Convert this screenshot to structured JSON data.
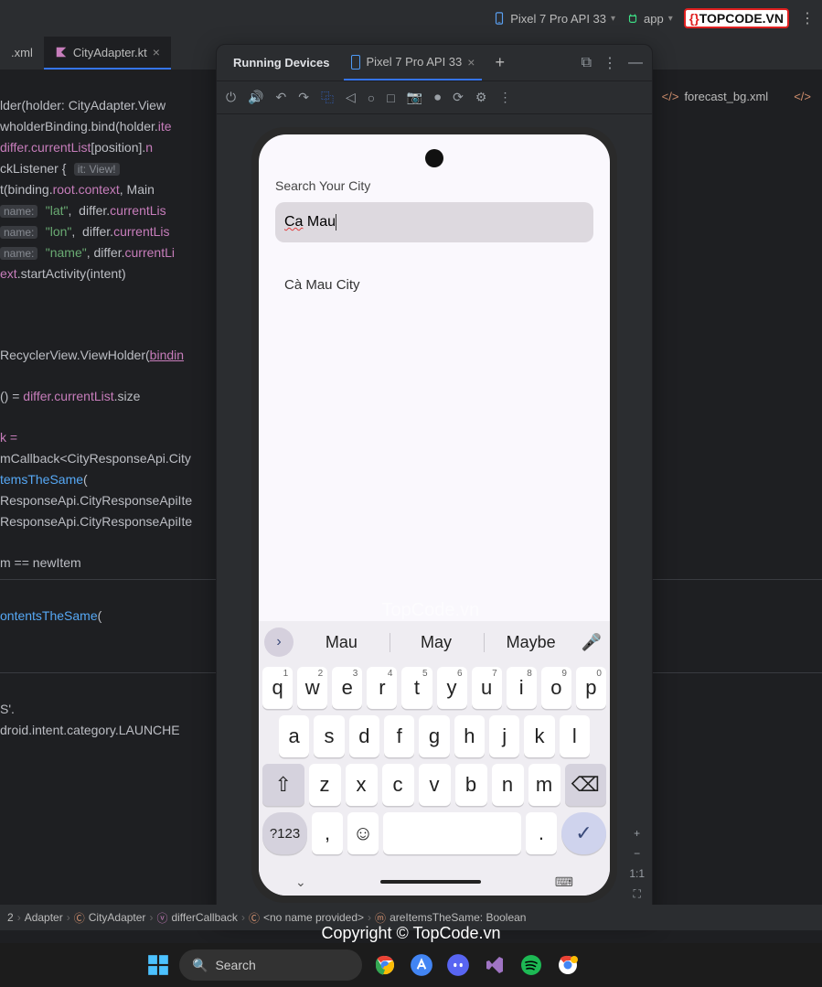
{
  "top_toolbar": {
    "device": "Pixel 7 Pro API 33",
    "run_config": "app"
  },
  "logo_text": "TOPCODE.VN",
  "editor_tabs": {
    "left_tail": ".xml",
    "active": "CityAdapter.kt",
    "right1": "forecast_bg.xml"
  },
  "code": {
    "l1a": "lder(holder: CityAdapter.View",
    "l2a": "wholderBinding.bind(holder.",
    "l2b": "ite",
    "l3a": "differ",
    "l3b": ".currentList",
    "l3c": "[position].",
    "l3d": "n",
    "l4a": "ckListener {",
    "l4hint": "it: View!",
    "l5a": "t(binding.",
    "l5b": "root",
    "l5c": ".context",
    "l5d": ", Main",
    "l6hint": "name:",
    "l6a": "\"lat\"",
    "l6b": ",  differ.",
    "l6c": "currentLis",
    "l7hint": "name:",
    "l7a": "\"lon\"",
    "l7b": ",  differ.",
    "l7c": "currentLis",
    "l8hint": "name:",
    "l8a": "\"name\"",
    "l8b": ", differ.",
    "l8c": "currentLi",
    "l9a": "ext",
    "l9b": ".startActivity(intent)",
    "l10a": "RecyclerView.ViewHolder(",
    "l10b": "bindin",
    "l11a": "() = ",
    "l11b": "differ",
    "l11c": ".currentList",
    "l11d": ".size",
    "l12a": "k =",
    "l13a": "mCallback<CityResponseApi.City",
    "l14a": "temsTheSame",
    "l14b": "(",
    "l15": "ResponseApi.CityResponseApiIte",
    "l16": "ResponseApi.CityResponseApiIte",
    "l17a": "m == newItem",
    "l18a": "ontentsTheSame",
    "l18b": "(",
    "l19a": "S'.",
    "l20a": "droid.intent.category.LAUNCHE"
  },
  "panel": {
    "title": "Running Devices",
    "device_tab": "Pixel 7 Pro API 33"
  },
  "phone": {
    "search_label": "Search Your City",
    "search_value_underlined": "Ca",
    "search_value_rest": " Mau",
    "result": "Cà Mau City"
  },
  "suggestions": [
    "Mau",
    "May",
    "Maybe"
  ],
  "keyboard": {
    "row1": [
      {
        "k": "q",
        "s": "1"
      },
      {
        "k": "w",
        "s": "2"
      },
      {
        "k": "e",
        "s": "3"
      },
      {
        "k": "r",
        "s": "4"
      },
      {
        "k": "t",
        "s": "5"
      },
      {
        "k": "y",
        "s": "6"
      },
      {
        "k": "u",
        "s": "7"
      },
      {
        "k": "i",
        "s": "8"
      },
      {
        "k": "o",
        "s": "9"
      },
      {
        "k": "p",
        "s": "0"
      }
    ],
    "row2": [
      "a",
      "s",
      "d",
      "f",
      "g",
      "h",
      "j",
      "k",
      "l"
    ],
    "row3": [
      "z",
      "x",
      "c",
      "v",
      "b",
      "n",
      "m"
    ],
    "num_label": "?123",
    "comma": ",",
    "dot": "."
  },
  "zoom": {
    "ratio": "1:1"
  },
  "breadcrumb": {
    "b1": "2",
    "b2": "Adapter",
    "b3": "CityAdapter",
    "b4": "differCallback",
    "b5": "<no name provided>",
    "b6": "areItemsTheSame: Boolean"
  },
  "watermark_center": "TopCode.vn",
  "watermark_copyright": "Copyright © TopCode.vn",
  "taskbar": {
    "search": "Search"
  }
}
